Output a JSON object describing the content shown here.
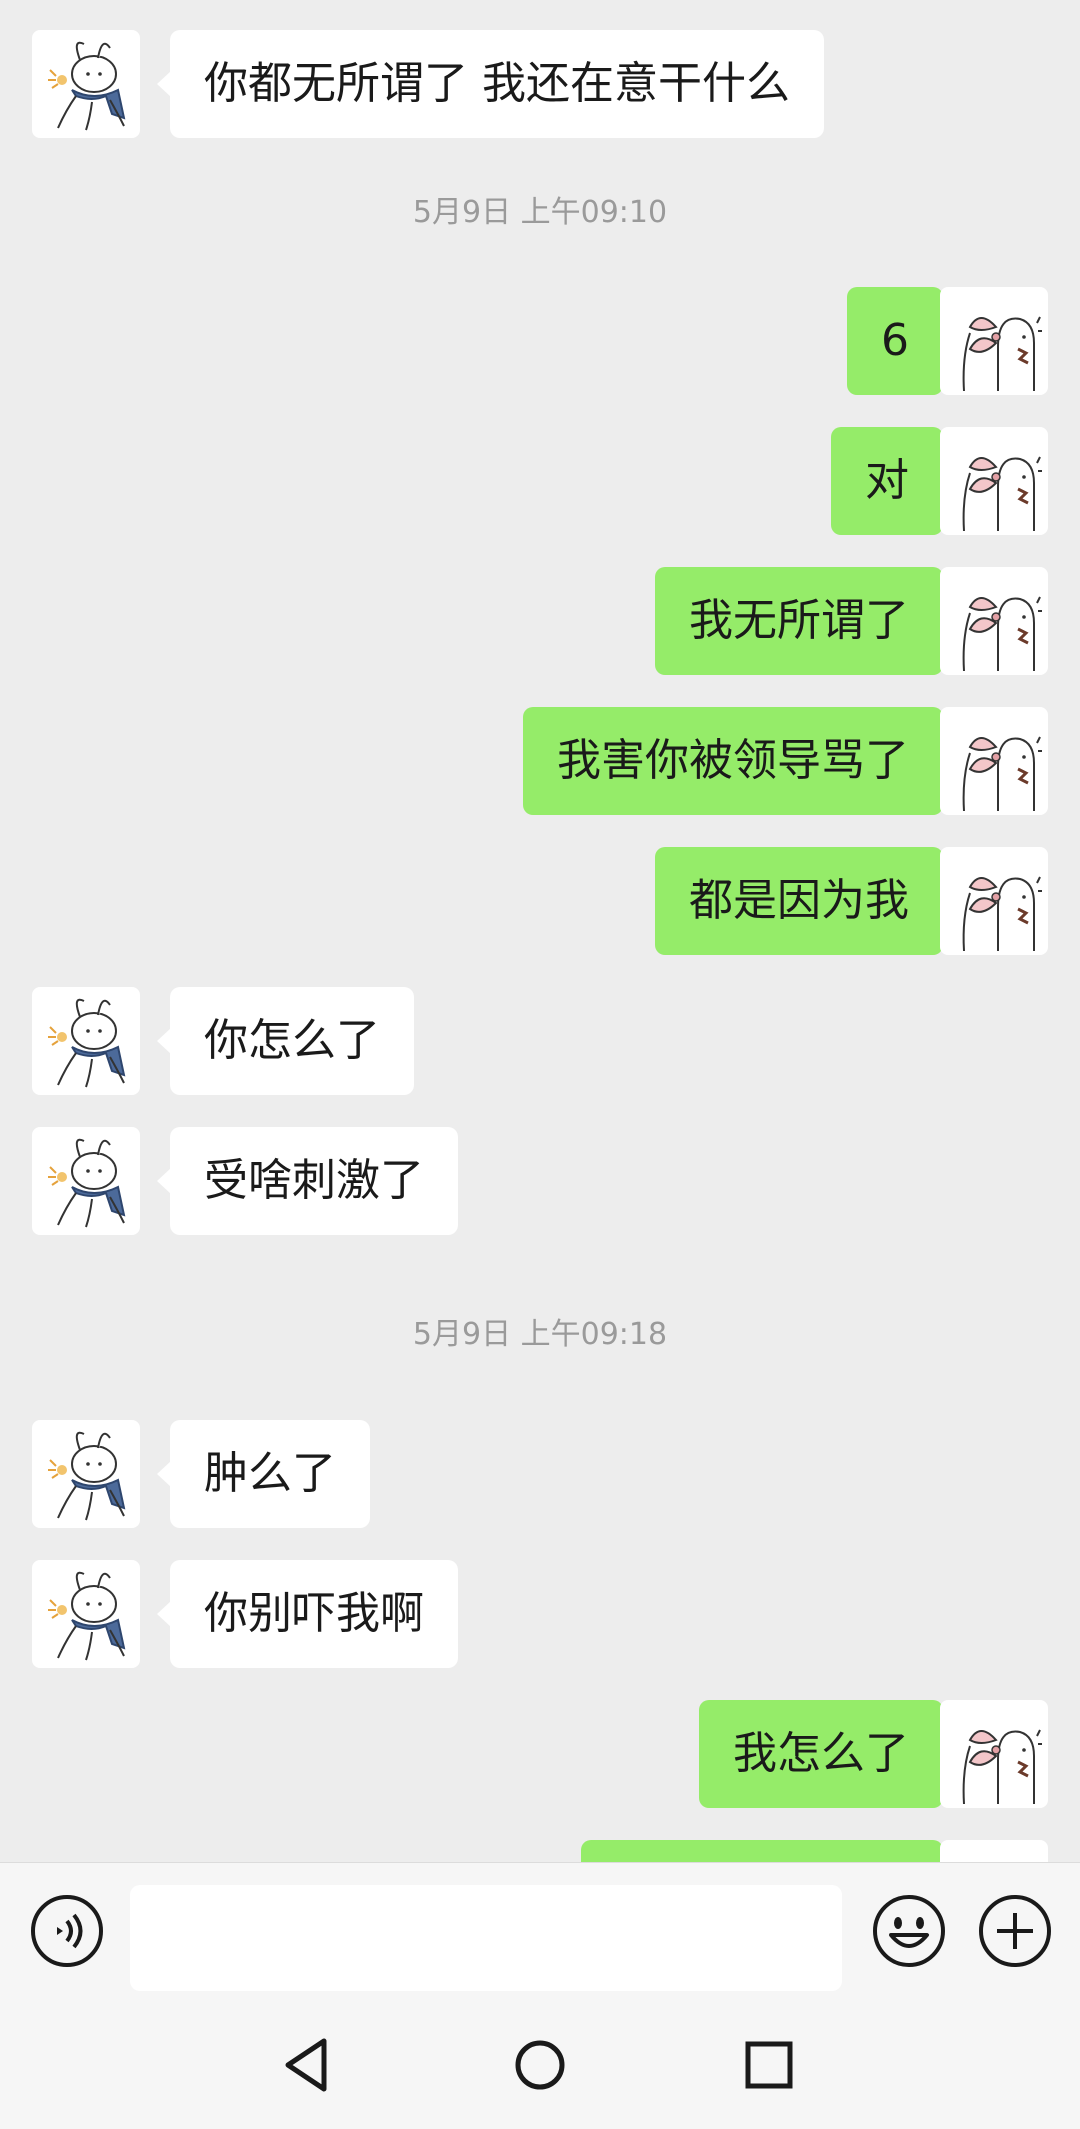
{
  "chat": {
    "timestamps": [
      "5月9日 上午09:10",
      "5月9日 上午09:18"
    ],
    "messages": [
      {
        "side": "in",
        "text": "你都无所谓了 我还在意干什么"
      },
      {
        "side": "out",
        "text": "6"
      },
      {
        "side": "out",
        "text": "对"
      },
      {
        "side": "out",
        "text": "我无所谓了"
      },
      {
        "side": "out",
        "text": "我害你被领导骂了"
      },
      {
        "side": "out",
        "text": "都是因为我"
      },
      {
        "side": "in",
        "text": "你怎么了"
      },
      {
        "side": "in",
        "text": "受啥刺激了"
      },
      {
        "side": "in",
        "text": "肿么了"
      },
      {
        "side": "in",
        "text": "你别吓我啊"
      },
      {
        "side": "out",
        "text": "我怎么了"
      },
      {
        "side": "out",
        "text": ""
      }
    ]
  },
  "input_bar": {
    "voice_icon": "voice-icon",
    "emoji_icon": "emoji-icon",
    "plus_icon": "plus-icon",
    "input_value": ""
  },
  "nav_bar": {
    "back_icon": "triangle-back-icon",
    "home_icon": "circle-home-icon",
    "recent_icon": "square-recent-icon"
  },
  "colors": {
    "background": "#ededed",
    "outgoing_bubble": "#95ec69",
    "incoming_bubble": "#ffffff",
    "timestamp": "#9a9a9a"
  }
}
